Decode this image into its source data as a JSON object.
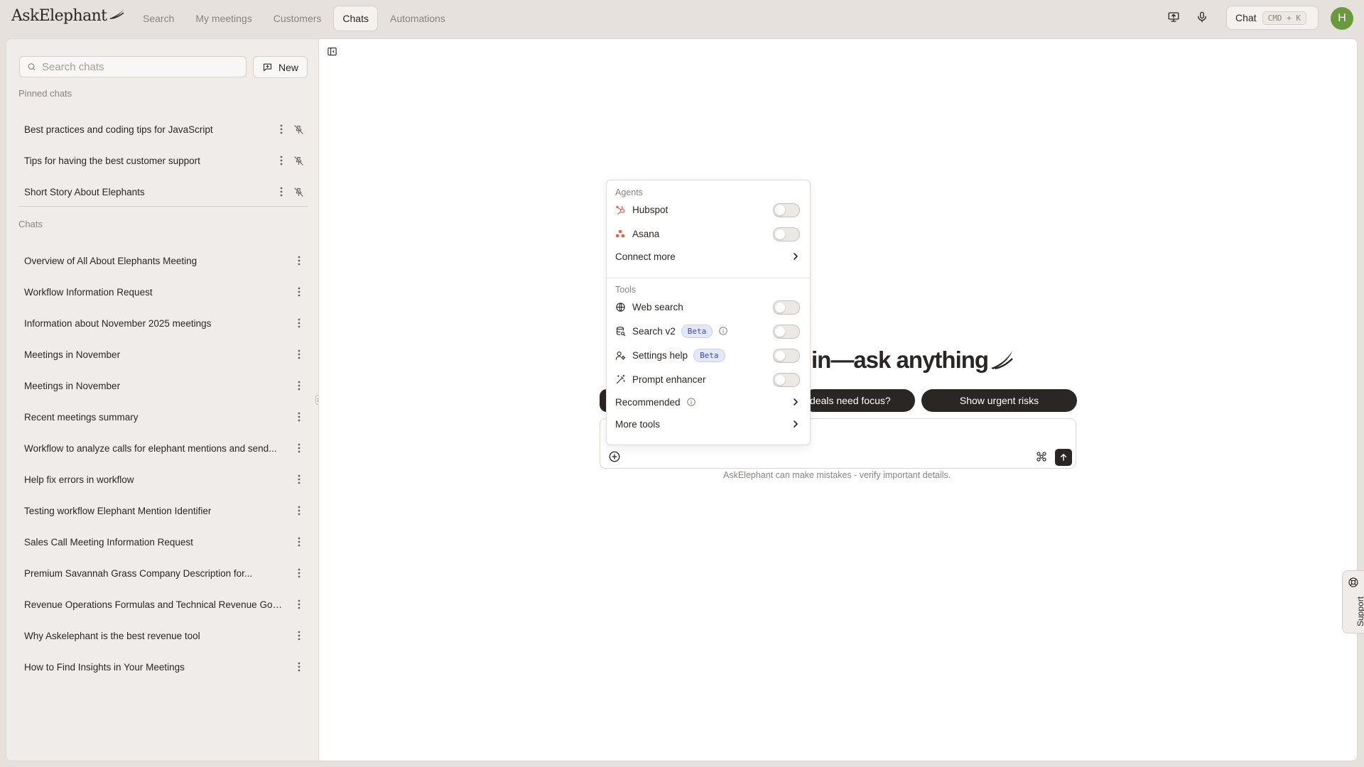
{
  "app": {
    "logo_text": "AskElephant"
  },
  "nav": {
    "items": [
      {
        "label": "Search"
      },
      {
        "label": "My meetings"
      },
      {
        "label": "Customers"
      },
      {
        "label": "Chats"
      },
      {
        "label": "Automations"
      }
    ],
    "active": "Chats"
  },
  "topbar": {
    "chat_label": "Chat",
    "chat_shortcut": "CMD + K",
    "avatar_initial": "H"
  },
  "sidebar": {
    "search_placeholder": "Search chats",
    "new_label": "New",
    "pinned_heading": "Pinned chats",
    "pinned": [
      {
        "label": "Best practices and coding tips for JavaScript"
      },
      {
        "label": "Tips for having the best customer support"
      },
      {
        "label": "Short Story About Elephants"
      }
    ],
    "chats_heading": "Chats",
    "chats": [
      {
        "label": "Overview of All About Elephants Meeting"
      },
      {
        "label": "Workflow Information Request"
      },
      {
        "label": "Information about November 2025 meetings"
      },
      {
        "label": "Meetings in November"
      },
      {
        "label": "Meetings in November"
      },
      {
        "label": "Recent meetings summary"
      },
      {
        "label": "Workflow to analyze calls for elephant mentions and send..."
      },
      {
        "label": "Help fix errors in workflow"
      },
      {
        "label": "Testing workflow Elephant Mention Identifier"
      },
      {
        "label": "Sales Call Meeting Information Request"
      },
      {
        "label": "Premium Savannah Grass Company Description for..."
      },
      {
        "label": "Revenue Operations Formulas and Technical Revenue Goal..."
      },
      {
        "label": "Why Askelephant is the best revenue tool"
      },
      {
        "label": "How to Find Insights in Your Meetings"
      }
    ]
  },
  "main": {
    "headline_visible": "in—ask anything",
    "suggestions": [
      {
        "label": "deals need focus?"
      },
      {
        "label": "Show urgent risks"
      }
    ],
    "disclaimer": "AskElephant can make mistakes - verify important details.",
    "support_label": "Support"
  },
  "menu": {
    "agents_heading": "Agents",
    "agents": [
      {
        "label": "Hubspot",
        "icon": "hubspot-icon",
        "enabled": false
      },
      {
        "label": "Asana",
        "icon": "asana-icon",
        "enabled": false
      }
    ],
    "connect_more": "Connect more",
    "tools_heading": "Tools",
    "tools": [
      {
        "label": "Web search",
        "icon": "globe-icon",
        "enabled": false
      },
      {
        "label": "Search v2",
        "icon": "database-search-icon",
        "badge": "Beta",
        "info": true,
        "enabled": false
      },
      {
        "label": "Settings help",
        "icon": "user-settings-icon",
        "badge": "Beta",
        "enabled": false
      },
      {
        "label": "Prompt enhancer",
        "icon": "magic-wand-icon",
        "enabled": false
      }
    ],
    "recommended": "Recommended",
    "more_tools": "More tools"
  },
  "colors": {
    "background": "#e6e1dc",
    "sidebar": "#efece9",
    "accent_dark": "#2a2623",
    "muted_text": "#8a837d",
    "avatar": "#6a9a3d",
    "hubspot": "#e8604c",
    "asana": "#e8604c",
    "beta_badge": "#e5e8fb"
  }
}
